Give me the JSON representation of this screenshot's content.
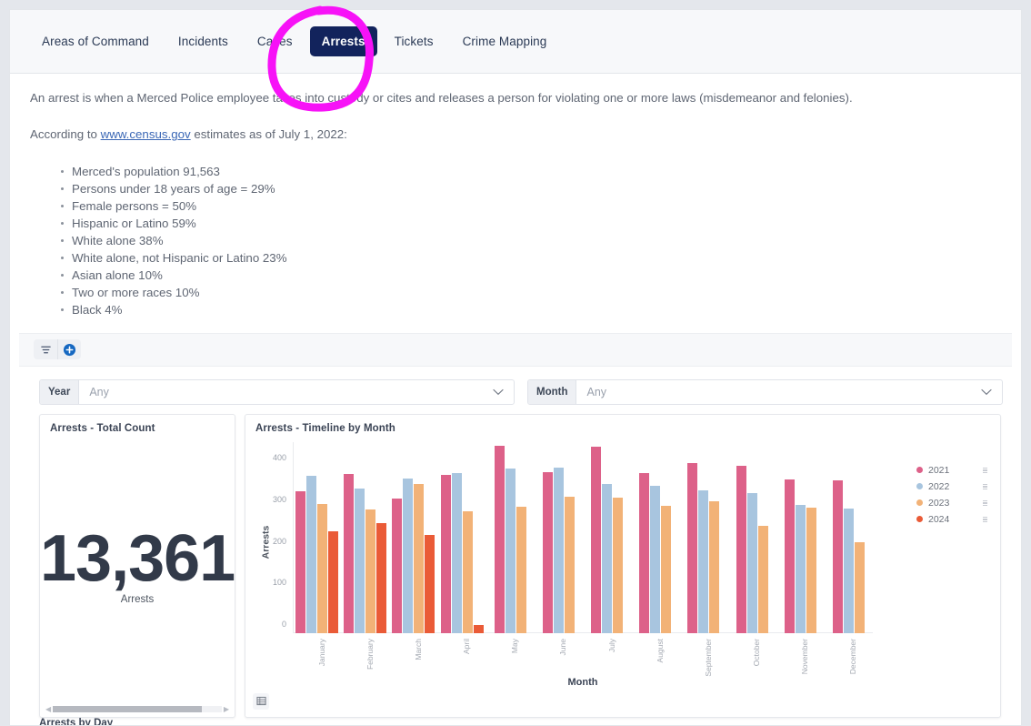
{
  "nav": {
    "tabs": [
      {
        "label": "Areas of Command",
        "active": false
      },
      {
        "label": "Incidents",
        "active": false
      },
      {
        "label": "Cases",
        "active": false
      },
      {
        "label": "Arrests",
        "active": true
      },
      {
        "label": "Tickets",
        "active": false
      },
      {
        "label": "Crime Mapping",
        "active": false
      }
    ]
  },
  "content": {
    "definition": "An arrest is when a Merced Police employee takes into custody or cites and releases a person for violating one or more laws (misdemeanor and felonies).",
    "source_prefix": "According to ",
    "source_link": "www.census.gov",
    "source_suffix": " estimates as of July 1, 2022:",
    "stats": [
      "Merced's population 91,563",
      "Persons under 18 years of age = 29%",
      "Female persons = 50%",
      "Hispanic or Latino 59%",
      "White alone 38%",
      "White alone, not Hispanic or Latino 23%",
      "Asian alone 10%",
      "Two or more races 10%",
      "Black 4%"
    ]
  },
  "toolbar": {
    "filter_icon": "filter-icon",
    "add_icon": "add-circle-icon"
  },
  "filters": [
    {
      "label": "Year",
      "value": "Any",
      "placeholder": "Any"
    },
    {
      "label": "Month",
      "value": "Any",
      "placeholder": "Any"
    }
  ],
  "total_card": {
    "title": "Arrests - Total Count",
    "value": "13,361",
    "unit": "Arrests"
  },
  "chart_card": {
    "title": "Arrests - Timeline by Month",
    "table_view_icon": "table-grid-icon"
  },
  "next_card": {
    "title": "Arrests by Day"
  },
  "chart_data": {
    "type": "bar",
    "title": "Arrests - Timeline by Month",
    "xlabel": "Month",
    "ylabel": "Arrests",
    "ylim": [
      0,
      460
    ],
    "yticks": [
      0,
      100,
      200,
      300,
      400
    ],
    "grid": false,
    "legend_position": "right",
    "categories": [
      "January",
      "February",
      "March",
      "April",
      "May",
      "June",
      "July",
      "August",
      "September",
      "October",
      "November",
      "December"
    ],
    "series": [
      {
        "name": "2021",
        "color": "#dd6189",
        "values": [
          341,
          382,
          325,
          381,
          452,
          388,
          448,
          385,
          409,
          403,
          371,
          368
        ]
      },
      {
        "name": "2022",
        "color": "#a8c5df",
        "values": [
          378,
          347,
          373,
          385,
          396,
          399,
          358,
          355,
          343,
          337,
          309,
          300
        ]
      },
      {
        "name": "2023",
        "color": "#f2b277",
        "values": [
          310,
          298,
          358,
          294,
          304,
          329,
          326,
          307,
          318,
          259,
          303,
          218
        ]
      },
      {
        "name": "2024",
        "color": "#ea5b37",
        "values": [
          245,
          265,
          237,
          19,
          null,
          null,
          null,
          null,
          null,
          null,
          null,
          null
        ]
      }
    ]
  },
  "annotation": {
    "shape": "hand-drawn-circle",
    "color": "#f712f7",
    "target": "Arrests"
  }
}
